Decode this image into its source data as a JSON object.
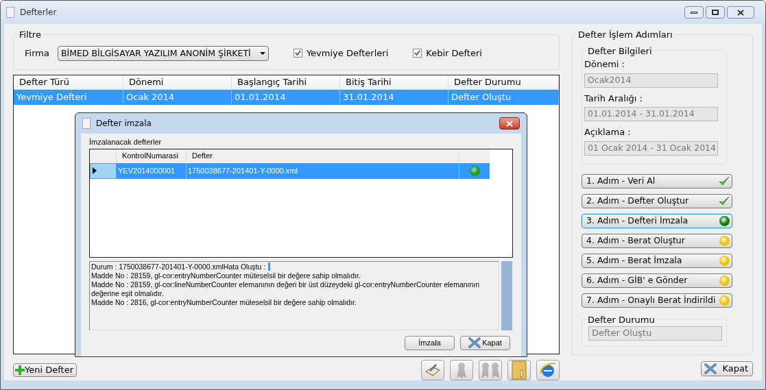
{
  "window": {
    "title": "Defterler"
  },
  "filter": {
    "title": "Filtre",
    "firma_label": "Firma",
    "firma_value": "BİMED BİLGİSAYAR YAZILIM ANONİM ŞİRKETİ",
    "checkboxes": [
      {
        "label": "Yevmiye Defterleri",
        "checked": true
      },
      {
        "label": "Kebir Defteri",
        "checked": true
      }
    ]
  },
  "table": {
    "columns": [
      "Defter Türü",
      "Dönemi",
      "Başlangıç Tarihi",
      "Bitiş Tarihi",
      "Defter Durumu"
    ],
    "rows": [
      {
        "selected": true,
        "cells": [
          "Yevmiye Defteri",
          "Ocak 2014",
          "01.01.2014",
          "31.01.2014",
          "Defter Oluştu"
        ]
      }
    ]
  },
  "new_button": "Yeni Defter",
  "toolbar": [
    {
      "kind": "book",
      "disabled": false
    },
    {
      "kind": "ribbon",
      "disabled": true
    },
    {
      "kind": "ribbons",
      "disabled": true
    },
    {
      "kind": "folder",
      "disabled": false
    },
    {
      "kind": "browser",
      "disabled": false
    }
  ],
  "steps_panel": {
    "title": "Defter İşlem Adımları",
    "info_title": "Defter Bilgileri",
    "fields": [
      {
        "label": "Dönemi :",
        "value": "Ocak2014"
      },
      {
        "label": "Tarih Aralığı :",
        "value": "01.01.2014 - 31.01.2014"
      },
      {
        "label": "Açıklama :",
        "value": "01 Ocak 2014 - 31 Ocak 2014"
      }
    ],
    "steps": [
      {
        "label": "1. Adım - Veri Al",
        "kind": "done",
        "selected": false
      },
      {
        "label": "2. Adım - Defter Oluştur",
        "kind": "done",
        "selected": false
      },
      {
        "label": "3. Adım - Defteri İmzala",
        "kind": "current",
        "selected": true
      },
      {
        "label": "4. Adım - Berat Oluştur",
        "kind": "pending",
        "selected": false
      },
      {
        "label": "5. Adım - Berat İmzala",
        "kind": "pending",
        "selected": false
      },
      {
        "label": "6. Adım - GİB' e Gönder",
        "kind": "pending",
        "selected": false
      },
      {
        "label": "7. Adım - Onaylı Berat İndirildi",
        "kind": "pending",
        "selected": false
      }
    ],
    "status_title": "Defter Durumu",
    "status_value": "Defter Oluştu"
  },
  "close_button": "Kapat",
  "dialog": {
    "title": "Defter imzala",
    "list_label": "İmzalanacak defterler",
    "columns": [
      "KontrolNumarasi",
      "Defter"
    ],
    "rows": [
      {
        "selected": true,
        "cells": [
          "YEV2014000001",
          "1750038677-201401-Y-0000.xml"
        ],
        "kind": "ok"
      }
    ],
    "log": [
      "Durum : 1750038677-201401-Y-0000.xmlHata Oluştu :",
      "Madde No : 28159, gl-cor:entryNumberCounter müteselsil bir değere sahip olmalıdır.",
      "Madde No : 28159, gl-cor:lineNumberCounter elemanının değeri bir üst düzeydeki gl-cor:entryNumberCounter elemanının değerine eşit olmalıdır.",
      "Madde No : 2816, gl-cor:entryNumberCounter müteselsil bir değere sahip olmalıdır."
    ],
    "buttons": [
      "İmzala",
      "Kapat"
    ]
  }
}
